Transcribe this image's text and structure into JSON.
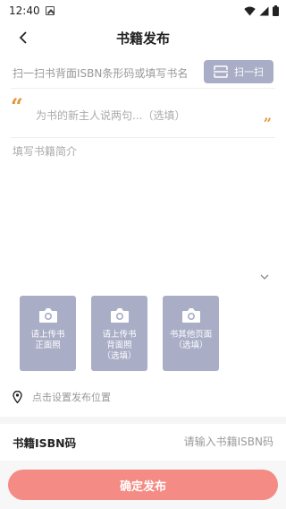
{
  "status_bar": {
    "time": "12:40"
  },
  "header": {
    "title": "书籍发布"
  },
  "scan": {
    "hint": "扫一扫书背面ISBN条形码或填写书名",
    "button_label": "扫一扫"
  },
  "quote": {
    "open": "“",
    "close": "”",
    "placeholder": "为书的新主人说两句...（选填）"
  },
  "intro": {
    "placeholder": "填写书籍简介"
  },
  "photos": [
    {
      "label": "请上传书\n正面照"
    },
    {
      "label": "请上传书\n背面照\n（选填）"
    },
    {
      "label": "书其他页面\n（选填）"
    }
  ],
  "location": {
    "text": "点击设置发布位置"
  },
  "isbn": {
    "label": "书籍ISBN码",
    "placeholder": "请输入书籍ISBN码",
    "value": ""
  },
  "submit": {
    "label": "确定发布"
  },
  "colors": {
    "accent": "#f48b84",
    "photo_bg": "#a9adc6",
    "quote": "#e6953a"
  },
  "icons": {
    "back": "back-arrow-icon",
    "scan": "scan-icon",
    "camera": "camera-icon",
    "location": "location-pin-icon",
    "collapse": "chevron-down-icon",
    "wifi": "wifi-icon",
    "signal": "signal-icon",
    "battery": "battery-icon",
    "notification": "notification-icon"
  }
}
